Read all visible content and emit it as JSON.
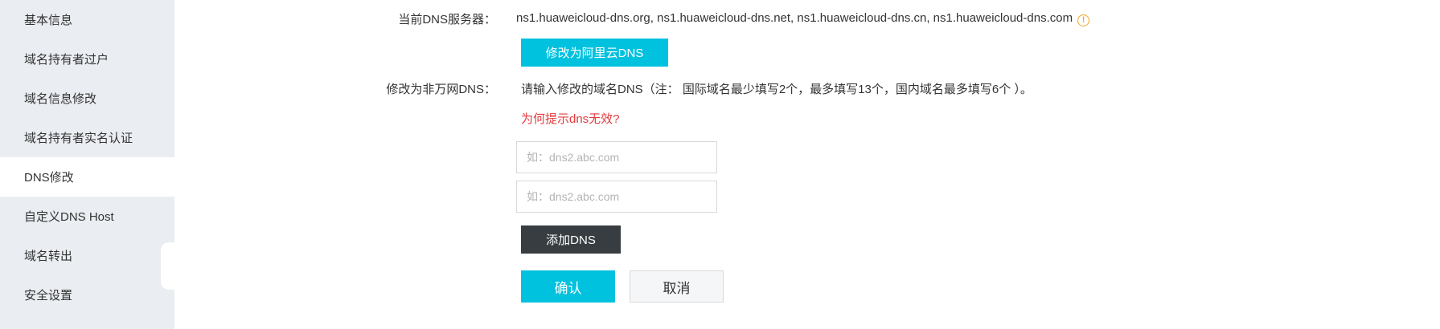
{
  "sidebar": {
    "items": [
      {
        "label": "基本信息",
        "active": false
      },
      {
        "label": "域名持有者过户",
        "active": false
      },
      {
        "label": "域名信息修改",
        "active": false
      },
      {
        "label": "域名持有者实名认证",
        "active": false
      },
      {
        "label": "DNS修改",
        "active": true
      },
      {
        "label": "自定义DNS Host",
        "active": false
      },
      {
        "label": "域名转出",
        "active": false
      },
      {
        "label": "安全设置",
        "active": false
      }
    ]
  },
  "main": {
    "current_dns_label": "当前DNS服务器：",
    "current_dns_value": "ns1.huaweicloud-dns.org, ns1.huaweicloud-dns.net, ns1.huaweicloud-dns.cn, ns1.huaweicloud-dns.com",
    "warning_icon": "info-warning-icon",
    "switch_aliyun_button": "修改为阿里云DNS",
    "non_wanwang_label": "修改为非万网DNS：",
    "instruction_text": "请输入修改的域名DNS（注： 国际域名最少填写2个，最多填写13个，国内域名最多填写6个 ）。",
    "help_link": "为何提示dns无效?",
    "dns_inputs": [
      {
        "value": "",
        "placeholder": "如：dns2.abc.com"
      },
      {
        "value": "",
        "placeholder": "如：dns2.abc.com"
      }
    ],
    "add_dns_button": "添加DNS",
    "confirm_button": "确认",
    "cancel_button": "取消"
  },
  "colors": {
    "sidebar_bg": "#eaedf1",
    "accent_cyan": "#00c1de",
    "dark_button": "#373d41",
    "link_red": "#e4393c",
    "warning_orange": "#f5a623"
  }
}
